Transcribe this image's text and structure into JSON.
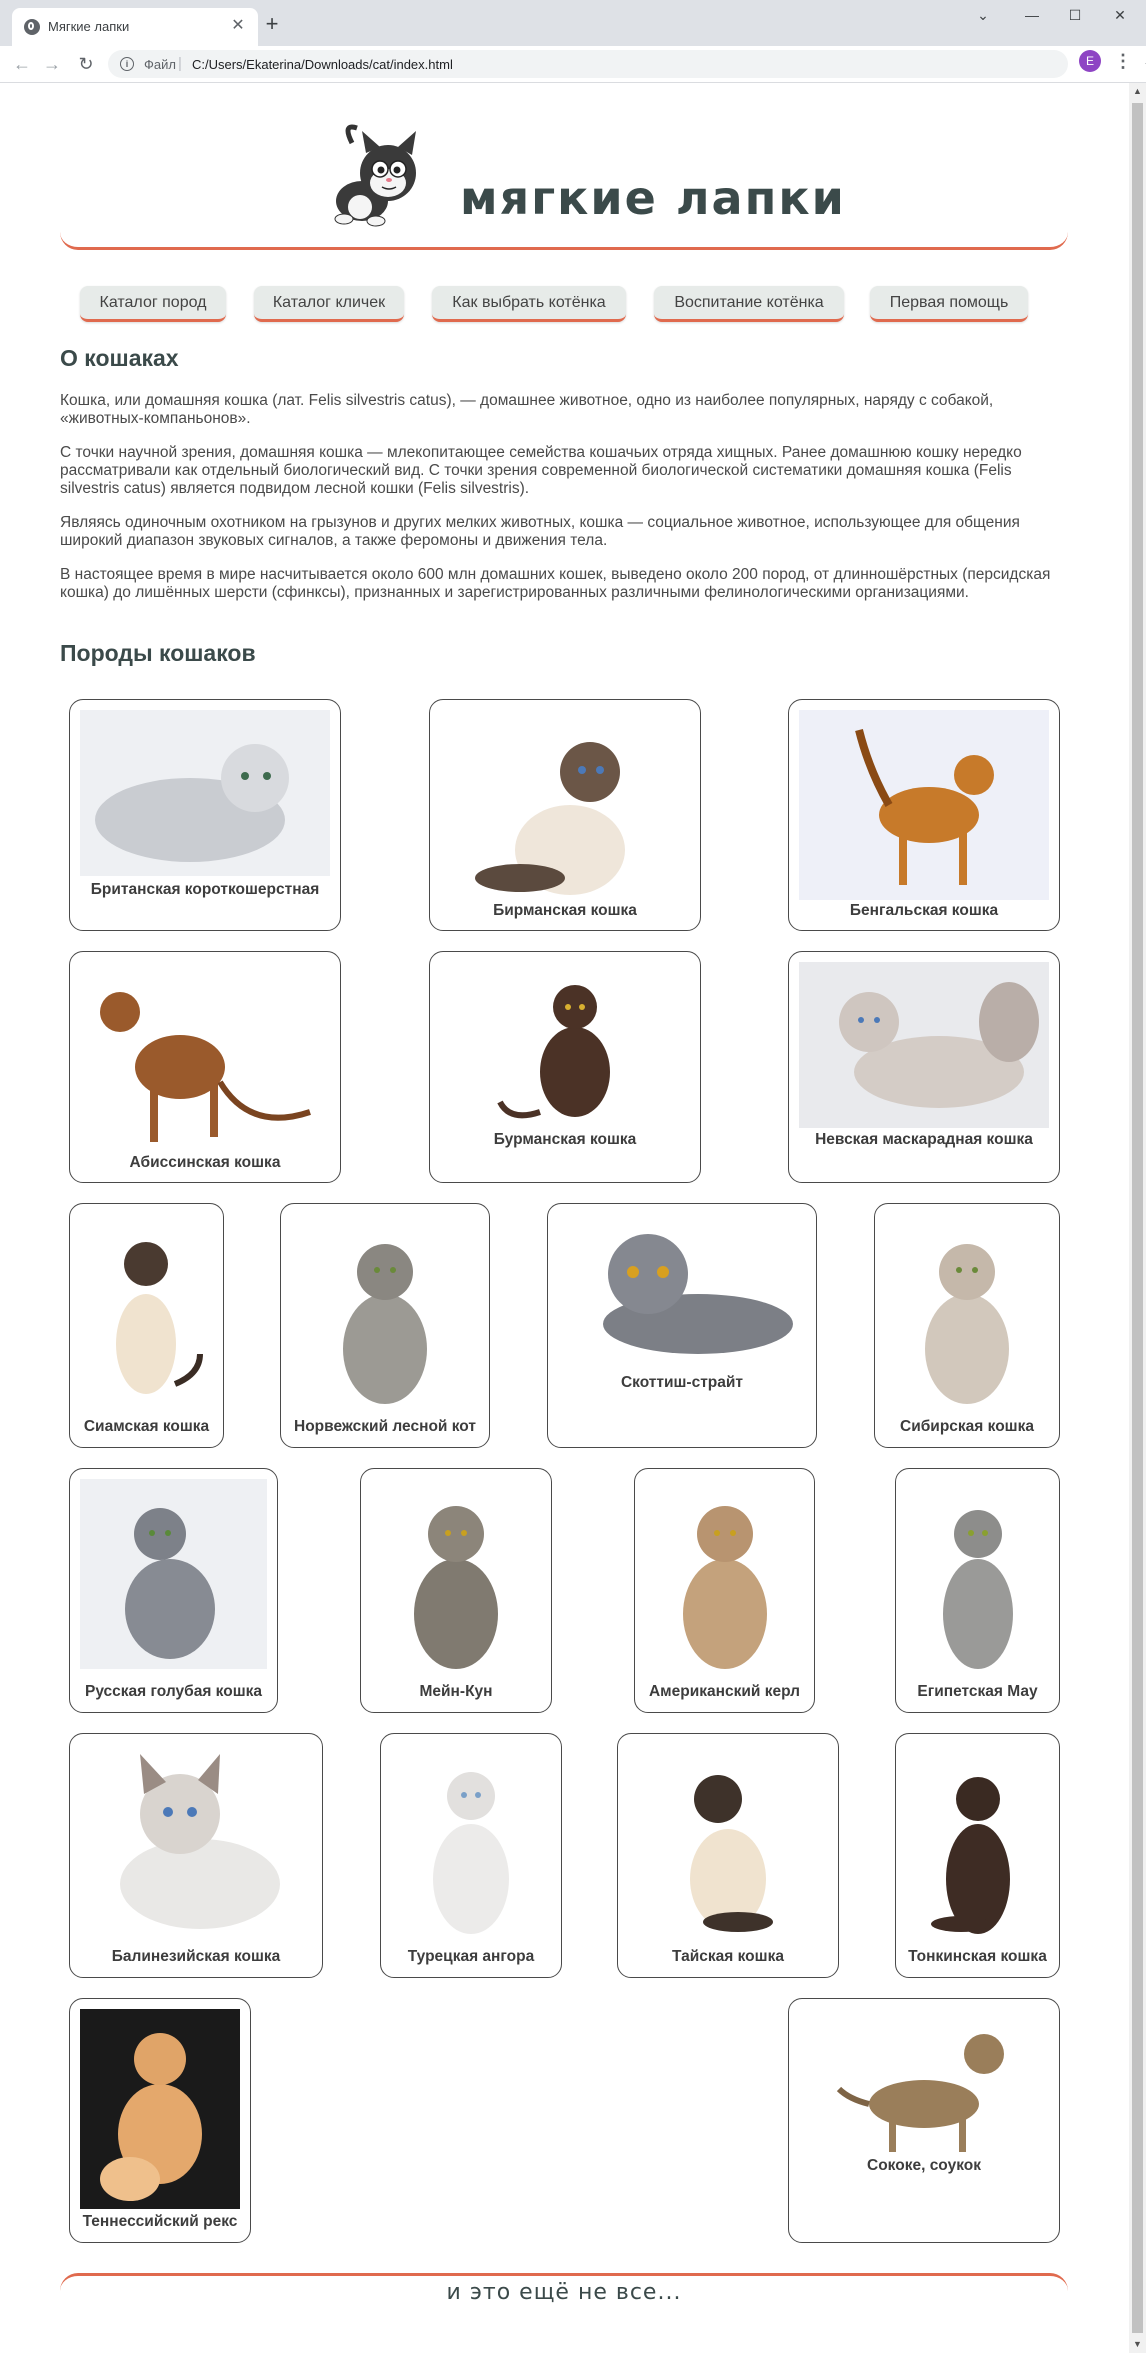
{
  "browser": {
    "tab_title": "Мягкие лапки",
    "tab_close": "✕",
    "new_tab": "+",
    "omnibox_scheme": "Файл",
    "omnibox_url": "C:/Users/Ekaterina/Downloads/cat/index.html",
    "profile_initial": "E",
    "window_controls": {
      "minimize": "—",
      "maximize": "☐",
      "close": "✕",
      "tab_search": "⌄"
    }
  },
  "site": {
    "title": "мягкие лапки",
    "accent_color": "#e06a4e",
    "nav": [
      "Каталог пород",
      "Каталог кличек",
      "Как выбрать котёнка",
      "Воспитание котёнка",
      "Первая помощь"
    ]
  },
  "about": {
    "heading": "О кошаках",
    "paragraphs": [
      "Кошка, или домашняя кошка (лат. Felis silvestris catus), — домашнее животное, одно из наиболее популярных, наряду с собакой, «животных-компаньонов».",
      "С точки научной зрения, домашняя кошка — млекопитающее семейства кошачьих отряда хищных. Ранее домашнюю кошку нередко рассматривали как отдельный биологический вид. С точки зрения современной биологической систематики домашняя кошка (Felis silvestris catus) является подвидом лесной кошки (Felis silvestris).",
      "Являясь одиночным охотником на грызунов и других мелких животных, кошка — социальное животное, использующее для общения широкий диапазон звуковых сигналов, а также феромоны и движения тела.",
      "В настоящее время в мире насчитывается около 600 млн домашних кошек, выведено около 200 пород, от длинношёрстных (персидская кошка) до лишённых шерсти (сфинксы), признанных и зарегистрированных различными фелинологическими организациями."
    ]
  },
  "breeds": {
    "heading": "Породы кошаков",
    "items": [
      "Британская короткошерстная",
      "Бирманская кошка",
      "Бенгальская кошка",
      "Абиссинская кошка",
      "Бурманская кошка",
      "Невская маскарадная кошка",
      "Сиамская кошка",
      "Норвежский лесной кот",
      "Скоттиш-страйт",
      "Сибирская кошка",
      "Русская голубая кошка",
      "Мейн-Кун",
      "Американский керл",
      "Египетская Мау",
      "Балинезийская кошка",
      "Турецкая ангора",
      "Тайская кошка",
      "Тонкинская кошка",
      "Теннессийский рекс",
      "Сококе, соукок"
    ]
  },
  "footer": {
    "text": "и это ещё не все..."
  }
}
